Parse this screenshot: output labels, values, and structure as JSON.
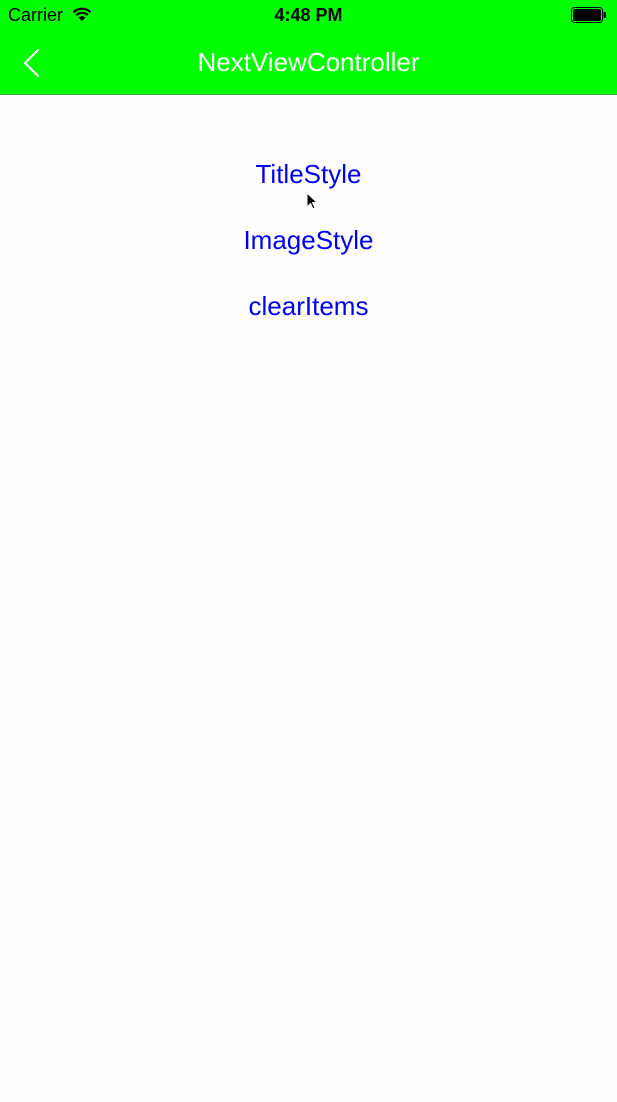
{
  "status_bar": {
    "carrier": "Carrier",
    "time": "4:48 PM",
    "icons": [
      "wifi-icon",
      "battery-icon"
    ]
  },
  "nav_bar": {
    "title": "NextViewController",
    "back_icon": "chevron-left-icon",
    "background_color": "#00ff00",
    "title_color": "#ffffff"
  },
  "buttons": [
    {
      "label": "TitleStyle"
    },
    {
      "label": "ImageStyle"
    },
    {
      "label": "clearItems"
    }
  ],
  "colors": {
    "button_text": "#0000ee",
    "page_background": "#fefefe"
  }
}
